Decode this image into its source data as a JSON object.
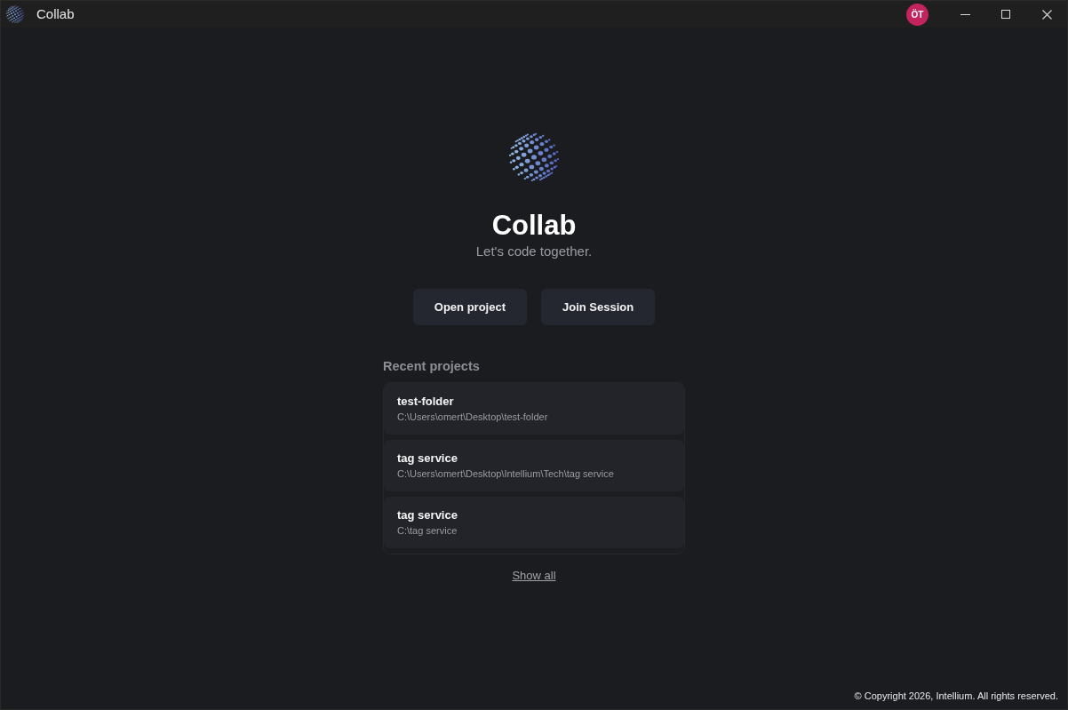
{
  "window": {
    "title": "Collab",
    "user_initials": "ÖT"
  },
  "hero": {
    "title": "Collab",
    "tagline": "Let's code together."
  },
  "actions": [
    "Open project",
    "Join Session"
  ],
  "recent_projects": {
    "heading": "Recent projects",
    "items": [
      {
        "name": "test-folder",
        "path": "C:\\Users\\omert\\Desktop\\test-folder"
      },
      {
        "name": "tag service",
        "path": "C:\\Users\\omert\\Desktop\\Intellium\\Tech\\tag service"
      },
      {
        "name": "tag service",
        "path": "C:\\tag service"
      }
    ]
  },
  "show_all": "Show all",
  "footer": {
    "copyright": "© Copyright 2026, Intellium. All rights reserved."
  }
}
